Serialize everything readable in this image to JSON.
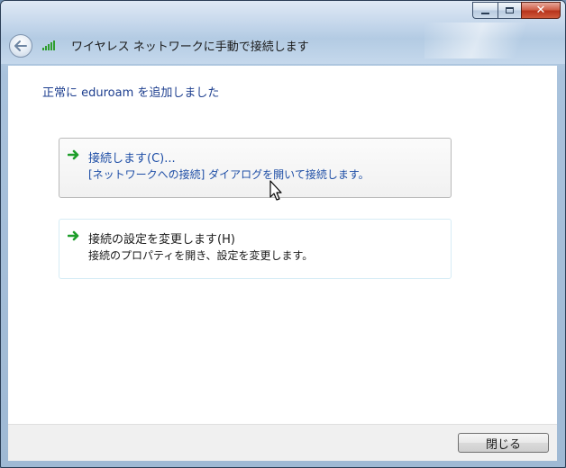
{
  "window": {
    "title": "ワイヤレス ネットワークに手動で接続します",
    "controls": {
      "minimize": "minimize-icon",
      "maximize": "maximize-icon",
      "close": "close-icon"
    }
  },
  "content": {
    "success_message": "正常に eduroam を追加しました",
    "options": [
      {
        "title": "接続します(C)...",
        "description": "[ネットワークへの接続] ダイアログを開いて接続します。",
        "state": "hover"
      },
      {
        "title": "接続の設定を変更します(H)",
        "description": "接続のプロパティを開き、設定を変更します。",
        "state": "normal"
      }
    ]
  },
  "footer": {
    "close_label": "閉じる"
  },
  "colors": {
    "link_blue": "#1e3f8f",
    "arrow_green": "#1e9e2a",
    "hover_border": "#b9b9b9",
    "normal_border": "#d6ecf5"
  }
}
